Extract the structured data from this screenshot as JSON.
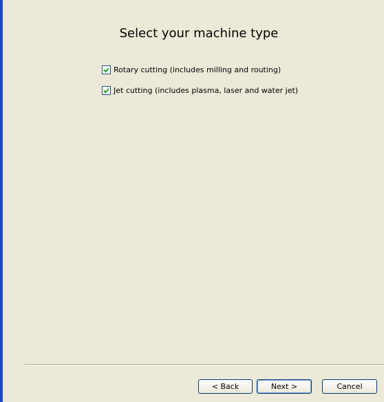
{
  "title": "Select your machine type",
  "options": [
    {
      "label": "Rotary cutting (includes milling and routing)",
      "checked": true
    },
    {
      "label": "Jet cutting (includes plasma, laser and water jet)",
      "checked": true
    }
  ],
  "buttons": {
    "back": "< Back",
    "next": "Next >",
    "cancel": "Cancel"
  },
  "colors": {
    "window_border": "#1a46c8",
    "background": "#ece9d8",
    "checkmark": "#21a121"
  }
}
